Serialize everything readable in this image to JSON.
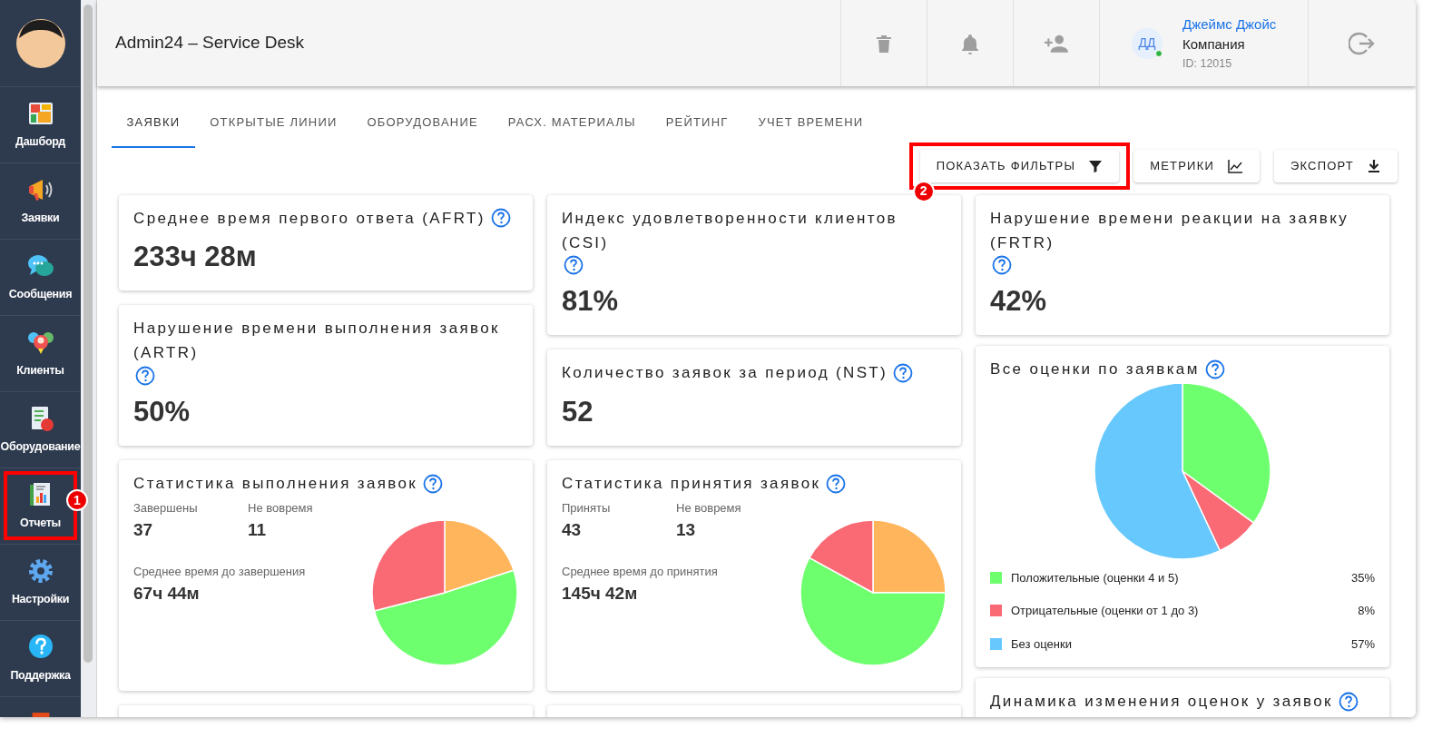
{
  "window": {
    "title": "Admin24 – Service Desk"
  },
  "sidebar": {
    "items": [
      {
        "label": "Дашборд",
        "kind": "dashboard",
        "selected": false
      },
      {
        "label": "Заявки",
        "kind": "megaphone",
        "selected": false
      },
      {
        "label": "Сообщения",
        "kind": "chat",
        "selected": false
      },
      {
        "label": "Клиенты",
        "kind": "people",
        "selected": false
      },
      {
        "label": "Оборудование",
        "kind": "equipment",
        "selected": false
      },
      {
        "label": "Отчеты",
        "kind": "report",
        "selected": false,
        "callout": "1"
      },
      {
        "label": "Настройки",
        "kind": "gear",
        "selected": false
      },
      {
        "label": "Поддержка",
        "kind": "help",
        "selected": false
      },
      {
        "kind": "partial",
        "selected": false
      }
    ]
  },
  "header": {
    "toolbar": [
      {
        "kind": "trash"
      },
      {
        "kind": "bell"
      },
      {
        "kind": "person-add"
      }
    ],
    "user": {
      "initials": "ДД",
      "online": true,
      "name": "Джеймс Джойс",
      "company": "Компания",
      "id": "ID: 12015"
    }
  },
  "tabs": [
    {
      "label": "ЗАЯВКИ",
      "selected": true
    },
    {
      "label": "ОТКРЫТЫЕ ЛИНИИ",
      "selected": false
    },
    {
      "label": "ОБОРУДОВАНИЕ",
      "selected": false
    },
    {
      "label": "РАСХ. МАТЕРИАЛЫ",
      "selected": false
    },
    {
      "label": "РЕЙТИНГ",
      "selected": false
    },
    {
      "label": "УЧЕТ ВРЕМЕНИ",
      "selected": false
    }
  ],
  "actions": [
    {
      "label": "ПОКАЗАТЬ ФИЛЬТРЫ",
      "kind": "filter",
      "callout": "2"
    },
    {
      "label": "МЕТРИКИ",
      "kind": "chart"
    },
    {
      "label": "ЭКСПОРТ",
      "kind": "download"
    }
  ],
  "columns": [
    [
      {
        "kind": "metric",
        "title": "Среднее время первого ответа (AFRT)",
        "value": "233ч 28м"
      },
      {
        "kind": "metric",
        "title": "Нарушение времени выполнения заявок (ARTR)",
        "value": "50%"
      },
      {
        "kind": "stats",
        "title": "Статистика выполнения заявок",
        "stats": [
          {
            "label": "Завершены",
            "value": "37"
          },
          {
            "label": "Не вовремя",
            "value": "11"
          }
        ],
        "avg_label": "Среднее время до завершения",
        "avg_value": "67ч 44м"
      },
      {
        "kind": "empty"
      }
    ],
    [
      {
        "kind": "metric",
        "title": "Индекс удовлетворенности клиентов (CSI)",
        "value": "81%"
      },
      {
        "kind": "metric",
        "title": "Количество заявок за период (NST)",
        "value": "52"
      },
      {
        "kind": "stats",
        "title": "Статистика принятия заявок",
        "stats": [
          {
            "label": "Приняты",
            "value": "43"
          },
          {
            "label": "Не вовремя",
            "value": "13"
          }
        ],
        "avg_label": "Среднее время до принятия",
        "avg_value": "145ч 42м"
      },
      {
        "kind": "empty"
      }
    ],
    [
      {
        "kind": "metric",
        "title": "Нарушение времени реакции на заявку (FRTR)",
        "value": "42%"
      },
      {
        "kind": "ratings",
        "title": "Все оценки по заявкам",
        "chart_data": {
          "type": "pie",
          "categories": [
            "Положительные (оценки 4 и 5)",
            "Отрицательные (оценки от 1 до 3)",
            "Без оценки"
          ],
          "values": [
            35,
            8,
            57
          ],
          "value_labels": [
            "35%",
            "8%",
            "57%"
          ],
          "colors": [
            "#6eff6e",
            "#f96a74",
            "#66c8fc"
          ]
        }
      },
      {
        "kind": "title-only",
        "title": "Динамика изменения оценок у заявок"
      }
    ]
  ]
}
